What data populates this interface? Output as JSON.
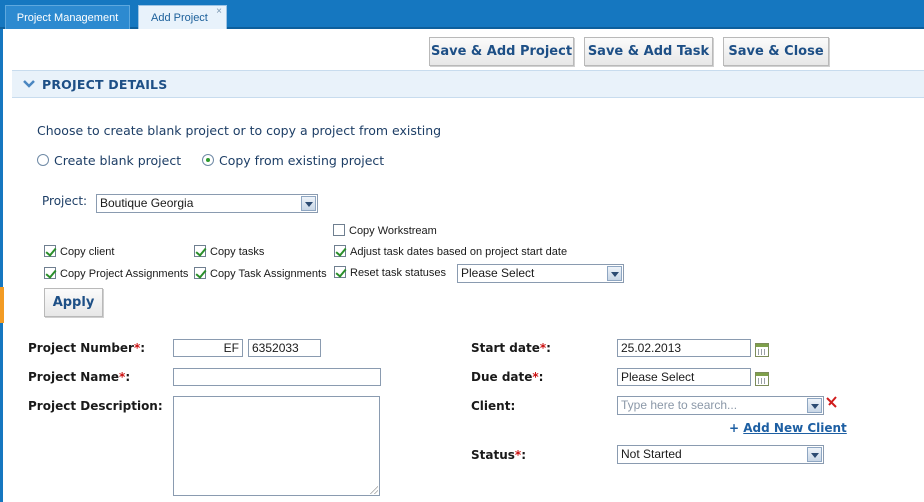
{
  "tabs": [
    {
      "label": "Project Management"
    },
    {
      "label": "Add Project",
      "close": "×"
    }
  ],
  "toolbar": {
    "save_add_project": "Save & Add Project",
    "save_add_task": "Save & Add Task",
    "save_close": "Save & Close"
  },
  "section": {
    "title": "PROJECT DETAILS"
  },
  "copy": {
    "intro": "Choose to create blank project or to copy a project from existing",
    "option_blank": "Create blank project",
    "option_copy": "Copy from existing project",
    "selected_option": "copy",
    "project_label": "Project:",
    "project_value": "Boutique Georgia",
    "checkboxes": {
      "copy_workstream": {
        "label": "Copy Workstream",
        "checked": false
      },
      "copy_client": {
        "label": "Copy client",
        "checked": true
      },
      "copy_tasks": {
        "label": "Copy tasks",
        "checked": true
      },
      "adjust_dates": {
        "label": "Adjust task dates based on project start date",
        "checked": true
      },
      "copy_project_assignments": {
        "label": "Copy Project Assignments",
        "checked": true
      },
      "copy_task_assignments": {
        "label": "Copy Task Assignments",
        "checked": true
      },
      "reset_statuses": {
        "label": "Reset task statuses",
        "checked": true
      }
    },
    "status_select": "Please Select",
    "apply_label": "Apply"
  },
  "form": {
    "project_number": {
      "label": "Project Number",
      "prefix": "EF",
      "number": "6352033"
    },
    "project_name": {
      "label": "Project Name",
      "value": ""
    },
    "project_description": {
      "label": "Project Description:"
    },
    "start_date": {
      "label": "Start date",
      "value": "25.02.2013"
    },
    "due_date": {
      "label": "Due date",
      "value": "Please Select"
    },
    "client": {
      "label": "Client:",
      "placeholder": "Type here to search..."
    },
    "add_client": {
      "prefix": "+",
      "link": "Add New Client"
    },
    "status": {
      "label": "Status",
      "value": "Not Started"
    },
    "required_mark": "*",
    "colon": ":"
  }
}
